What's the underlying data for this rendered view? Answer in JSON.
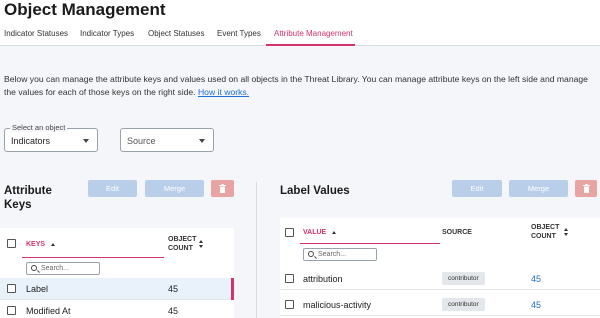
{
  "page": {
    "title": "Object Management"
  },
  "tabs": [
    {
      "label": "Indicator Statuses"
    },
    {
      "label": "Indicator Types"
    },
    {
      "label": "Object Statuses"
    },
    {
      "label": "Event Types"
    },
    {
      "label": "Attribute Management",
      "active": true
    }
  ],
  "description": {
    "text": "Below you can manage the attribute keys and values used on all objects in the Threat Library. You can manage attribute keys on the left side and manage the values for each of those keys on the right side.",
    "link": "How it works."
  },
  "filters": {
    "object_select": {
      "label": "Select an object",
      "value": "Indicators"
    },
    "source_select": {
      "placeholder": "Source"
    }
  },
  "left": {
    "title": "Attribute Keys",
    "buttons": {
      "edit": "Edit",
      "merge": "Merge",
      "delete_icon": "trash-icon"
    },
    "columns": {
      "keys": "KEYS",
      "count": "OBJECT COUNT"
    },
    "search_placeholder": "Search...",
    "rows": [
      {
        "name": "Label",
        "count": "45",
        "selected": true
      },
      {
        "name": "Modified At",
        "count": "45"
      }
    ]
  },
  "right": {
    "title": "Label Values",
    "buttons": {
      "edit": "Edit",
      "merge": "Merge",
      "delete_icon": "trash-icon"
    },
    "columns": {
      "value": "VALUE",
      "source": "SOURCE",
      "count": "OBJECT COUNT"
    },
    "search_placeholder": "Search...",
    "rows": [
      {
        "value": "attribution",
        "source": "contributor",
        "count": "45"
      },
      {
        "value": "malicious-activity",
        "source": "contributor",
        "count": "45"
      }
    ]
  },
  "colors": {
    "accent": "#d6336c",
    "link": "#1f6fd1",
    "button_blue_disabled": "#b9cfe9",
    "button_red_disabled": "#e8a3a3"
  }
}
